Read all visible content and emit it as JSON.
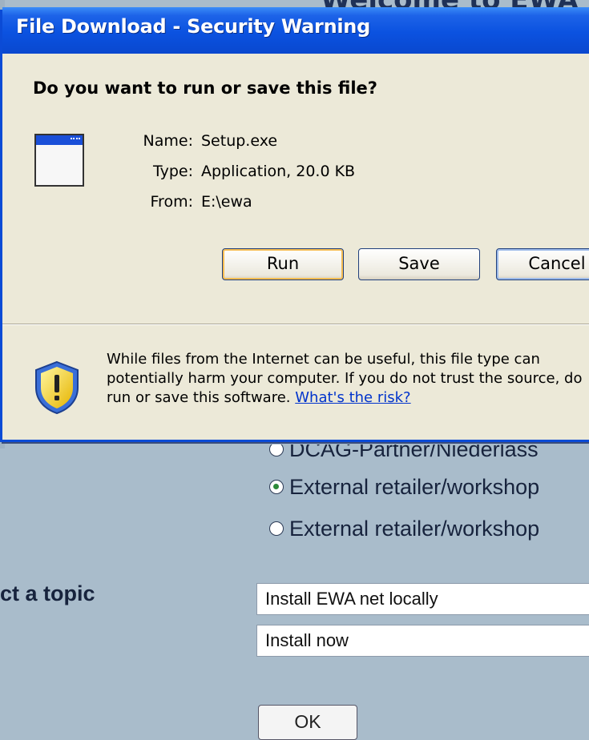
{
  "background_page": {
    "heading_fragment": "Welcome to EWA",
    "radio_options": [
      {
        "label": "DCAG-Partner/Niederlass",
        "checked": false
      },
      {
        "label": "External retailer/workshop",
        "checked": true
      },
      {
        "label": "External retailer/workshop",
        "checked": false
      }
    ],
    "topic_label": "ct a topic",
    "topic_select_value": "Install EWA net locally",
    "action_select_value": "Install now",
    "ok_label": "OK"
  },
  "dialog": {
    "title": "File Download - Security Warning",
    "question": "Do you want to run or save this file?",
    "fields": [
      {
        "key": "Name:",
        "value": "Setup.exe"
      },
      {
        "key": "Type:",
        "value": "Application, 20.0 KB"
      },
      {
        "key": "From:",
        "value": "E:\\ewa"
      }
    ],
    "buttons": {
      "run": "Run",
      "save": "Save",
      "cancel": "Cancel"
    },
    "warning": {
      "line1": "While files from the Internet can be useful, this file type can",
      "line2": "potentially harm your computer. If you do not trust the source, do",
      "line3_prefix": "run or save this software. ",
      "link": "What's the risk?"
    },
    "colors": {
      "title_bar": "#0b52e0",
      "dialog_bg": "#ece9d8",
      "link": "#0033cc"
    }
  }
}
